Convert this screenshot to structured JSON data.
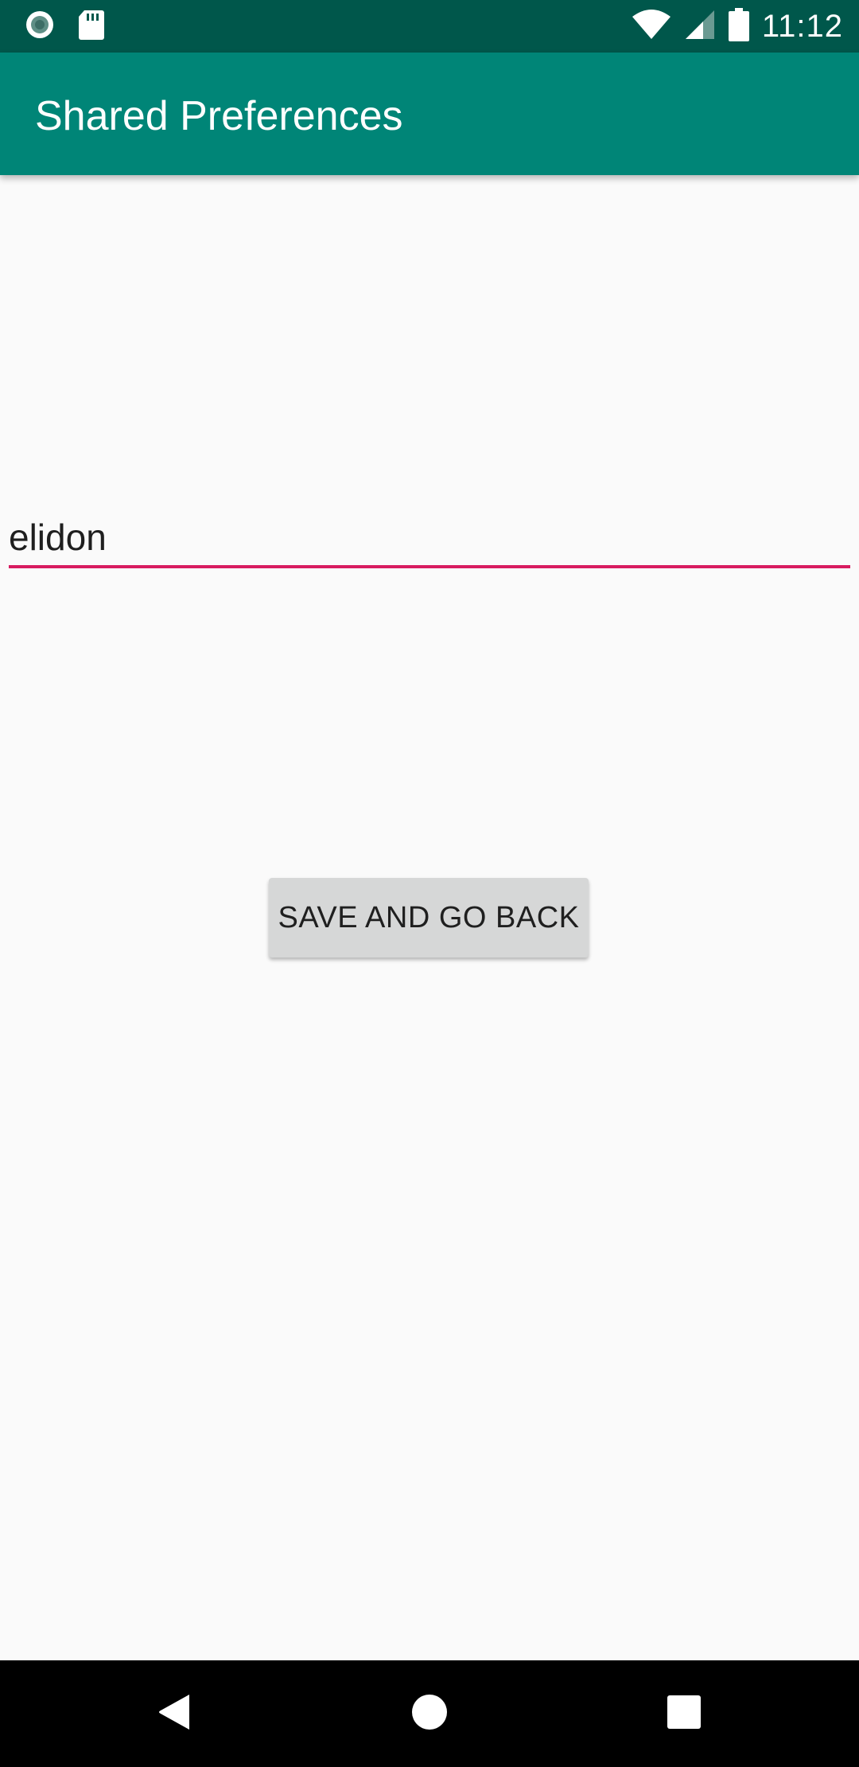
{
  "status_bar": {
    "time": "11:12",
    "icons": [
      "notification-circle-icon",
      "sd-card-icon",
      "wifi-icon",
      "signal-icon",
      "battery-icon"
    ],
    "background": "#00574b"
  },
  "app_bar": {
    "title": "Shared Preferences",
    "background": "#008577"
  },
  "form": {
    "input_value": "elidon",
    "underline_color": "#d81b60",
    "save_button_label": "SAVE AND GO BACK"
  },
  "nav_bar": {
    "icons": [
      "back-icon",
      "home-icon",
      "recents-icon"
    ]
  }
}
